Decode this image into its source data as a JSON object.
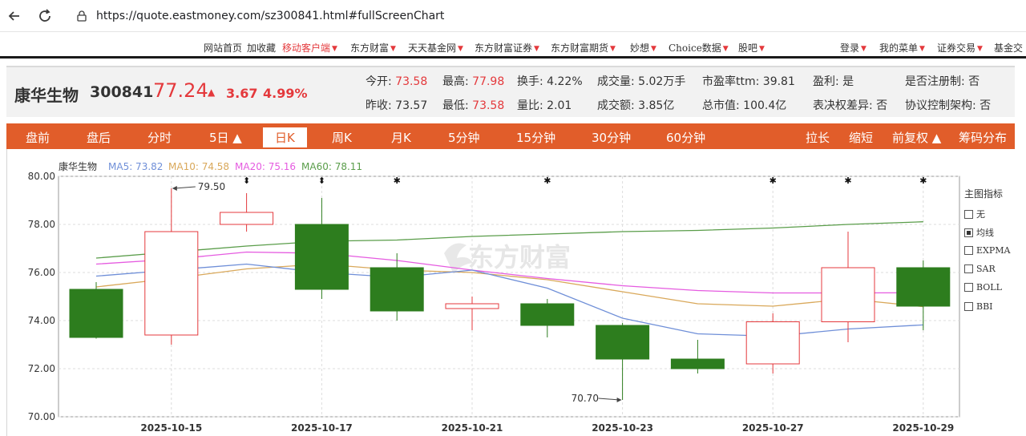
{
  "browser": {
    "url": "https://quote.eastmoney.com/sz300841.html#fullScreenChart"
  },
  "site_nav": {
    "items": [
      {
        "label": "网站首页",
        "red": false,
        "caret": false
      },
      {
        "label": "加收藏",
        "red": false,
        "caret": false
      },
      {
        "label": "移动客户端",
        "red": true,
        "caret": true
      },
      {
        "label": "东方财富",
        "red": false,
        "caret": true
      },
      {
        "label": "天天基金网",
        "red": false,
        "caret": true
      },
      {
        "label": "东方财富证券",
        "red": false,
        "caret": true
      },
      {
        "label": "东方财富期货",
        "red": false,
        "caret": true
      },
      {
        "label": "妙想",
        "red": false,
        "caret": true
      },
      {
        "label": "Choice数据",
        "red": false,
        "caret": true
      },
      {
        "label": "股吧",
        "red": false,
        "caret": true
      }
    ],
    "right_items": [
      {
        "label": "登录",
        "caret": true
      },
      {
        "label": "我的菜单",
        "caret": true
      },
      {
        "label": "证券交易",
        "caret": true
      },
      {
        "label": "基金交",
        "caret": false
      }
    ]
  },
  "quote": {
    "name": "康华生物",
    "code": "300841",
    "price": "77.24",
    "arrow": "▲",
    "change": "3.67",
    "pct": "4.99%",
    "stats_row1": [
      {
        "label": "今开:",
        "value": "73.58",
        "red": true
      },
      {
        "label": "最高:",
        "value": "77.98",
        "red": true
      },
      {
        "label": "换手:",
        "value": "4.22%",
        "red": false
      },
      {
        "label": "成交量:",
        "value": "5.02万手",
        "red": false
      },
      {
        "label": "市盈率ttm:",
        "value": "39.81",
        "red": false
      },
      {
        "label": "盈利:",
        "value": "是",
        "red": false
      },
      {
        "label": "是否注册制:",
        "value": "否",
        "red": false
      }
    ],
    "stats_row2": [
      {
        "label": "昨收:",
        "value": "73.57",
        "red": false
      },
      {
        "label": "最低:",
        "value": "73.58",
        "red": true
      },
      {
        "label": "量比:",
        "value": "2.01",
        "red": false
      },
      {
        "label": "成交额:",
        "value": "3.85亿",
        "red": false
      },
      {
        "label": "总市值:",
        "value": "100.4亿",
        "red": false
      },
      {
        "label": "表决权差异:",
        "value": "否",
        "red": false
      },
      {
        "label": "协议控制架构:",
        "value": "否",
        "red": false
      }
    ]
  },
  "period_tabs": {
    "left": [
      "盘前",
      "盘后",
      "分时",
      "5日 ▲",
      "日K",
      "周K",
      "月K",
      "5分钟",
      "15分钟",
      "30分钟",
      "60分钟"
    ],
    "active": "日K",
    "right": [
      "拉长",
      "缩短",
      "前复权 ▲",
      "筹码分布"
    ]
  },
  "indicator_panel": {
    "title": "主图指标",
    "items": [
      {
        "label": "无",
        "checked": false
      },
      {
        "label": "均线",
        "checked": true
      },
      {
        "label": "EXPMA",
        "checked": false
      },
      {
        "label": "SAR",
        "checked": false
      },
      {
        "label": "BOLL",
        "checked": false
      },
      {
        "label": "BBI",
        "checked": false
      }
    ]
  },
  "colors": {
    "up": "#e4393c",
    "down": "#2d7d1e",
    "ma5": "#6f8fd8",
    "ma10": "#d9a85a",
    "ma20": "#e55be0",
    "ma60": "#5a9d4a",
    "accent": "#e15d2a"
  },
  "chart_data": {
    "type": "candlestick",
    "legend": {
      "name": "康华生物",
      "ma": [
        {
          "label": "MA5: 73.82",
          "key": "ma5"
        },
        {
          "label": "MA10: 74.58",
          "key": "ma10"
        },
        {
          "label": "MA20: 75.16",
          "key": "ma20"
        },
        {
          "label": "MA60: 78.11",
          "key": "ma60"
        }
      ]
    },
    "watermark": "东方财富",
    "ylim": [
      70,
      80
    ],
    "yticks": [
      "70.00",
      "72.00",
      "74.00",
      "76.00",
      "78.00",
      "80.00"
    ],
    "xticks": [
      {
        "index": 1,
        "label": "2025-10-15"
      },
      {
        "index": 3,
        "label": "2025-10-17"
      },
      {
        "index": 5,
        "label": "2025-10-21"
      },
      {
        "index": 7,
        "label": "2025-10-23"
      },
      {
        "index": 9,
        "label": "2025-10-27"
      },
      {
        "index": 11,
        "label": "2025-10-29"
      }
    ],
    "candles": [
      {
        "open": 75.3,
        "close": 73.3,
        "high": 75.6,
        "low": 73.25
      },
      {
        "open": 73.4,
        "close": 77.7,
        "high": 79.5,
        "low": 73.0
      },
      {
        "open": 78.0,
        "close": 78.5,
        "high": 79.3,
        "low": 77.7
      },
      {
        "open": 78.0,
        "close": 75.3,
        "high": 79.1,
        "low": 74.9
      },
      {
        "open": 76.2,
        "close": 74.4,
        "high": 76.8,
        "low": 74.0
      },
      {
        "open": 74.5,
        "close": 74.7,
        "high": 75.0,
        "low": 73.6
      },
      {
        "open": 74.7,
        "close": 73.8,
        "high": 74.9,
        "low": 73.3
      },
      {
        "open": 73.8,
        "close": 72.4,
        "high": 73.9,
        "low": 70.7
      },
      {
        "open": 72.4,
        "close": 72.0,
        "high": 73.2,
        "low": 71.8
      },
      {
        "open": 72.2,
        "close": 73.95,
        "high": 74.3,
        "low": 71.8
      },
      {
        "open": 73.95,
        "close": 76.2,
        "high": 77.7,
        "low": 73.1
      },
      {
        "open": 76.2,
        "close": 74.6,
        "high": 76.5,
        "low": 73.6
      }
    ],
    "ma5": [
      75.85,
      76.1,
      76.35,
      76.0,
      75.8,
      76.1,
      75.35,
      74.1,
      73.45,
      73.35,
      73.65,
      73.82
    ],
    "ma10": [
      75.4,
      75.75,
      76.15,
      76.35,
      76.1,
      76.0,
      75.7,
      75.2,
      74.7,
      74.6,
      74.9,
      74.58
    ],
    "ma20": [
      76.35,
      76.55,
      76.85,
      76.8,
      76.5,
      76.1,
      75.75,
      75.45,
      75.25,
      75.15,
      75.15,
      75.16
    ],
    "ma60": [
      76.6,
      76.85,
      77.1,
      77.3,
      77.35,
      77.5,
      77.6,
      77.7,
      77.75,
      77.85,
      78.0,
      78.11
    ],
    "annotations": [
      {
        "index": 1,
        "value": 79.5,
        "label": "79.50"
      },
      {
        "index": 7,
        "value": 70.7,
        "label": "70.70"
      }
    ],
    "event_markers": [
      {
        "index": 2,
        "symbol": "⬍"
      },
      {
        "index": 3,
        "symbol": "⬍"
      },
      {
        "index": 4,
        "symbol": "✱"
      },
      {
        "index": 6,
        "symbol": "✱"
      },
      {
        "index": 9,
        "symbol": "✱"
      },
      {
        "index": 10,
        "symbol": "✱"
      },
      {
        "index": 11,
        "symbol": "✱"
      }
    ]
  }
}
